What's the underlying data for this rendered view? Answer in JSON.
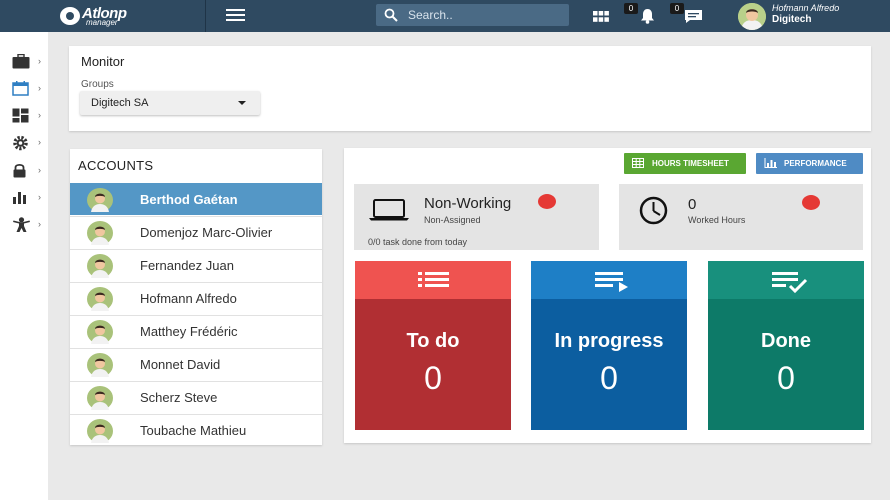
{
  "app": {
    "logo_main": "Atlonp",
    "logo_sub": "manager",
    "search_placeholder": "Search..",
    "notifications_count": "0",
    "messages_count": "0",
    "user_name": "Hofmann Alfredo",
    "user_org": "Digitech"
  },
  "sidebar": {
    "items": [
      {
        "icon": "briefcase-icon"
      },
      {
        "icon": "calendar-icon"
      },
      {
        "icon": "dashboard-icon"
      },
      {
        "icon": "gear-icon"
      },
      {
        "icon": "lock-icon"
      },
      {
        "icon": "bar-chart-icon"
      },
      {
        "icon": "person-icon"
      }
    ]
  },
  "monitor": {
    "title": "Monitor",
    "groups_label": "Groups",
    "groups_value": "Digitech SA"
  },
  "accounts": {
    "title": "ACCOUNTS",
    "items": [
      {
        "name": "Berthod Gaétan",
        "active": true
      },
      {
        "name": "Domenjoz Marc-Olivier"
      },
      {
        "name": "Fernandez Juan"
      },
      {
        "name": "Hofmann Alfredo"
      },
      {
        "name": "Matthey Frédéric"
      },
      {
        "name": "Monnet David"
      },
      {
        "name": "Scherz Steve"
      },
      {
        "name": "Toubache Mathieu"
      }
    ]
  },
  "dashboard": {
    "hours_timesheet_label": "HOURS TIMESHEET",
    "performance_label": "PERFORMANCE",
    "status_title": "Non-Working",
    "status_sub": "Non-Assigned",
    "tasks_done": "0/0 task done from today",
    "worked_hours_value": "0",
    "worked_hours_label": "Worked Hours",
    "tiles": [
      {
        "label": "To do",
        "count": "0",
        "top_color": "#ef5350",
        "bottom_color": "#b12f33"
      },
      {
        "label": "In progress",
        "count": "0",
        "top_color": "#1e7fc6",
        "bottom_color": "#0c5ea0"
      },
      {
        "label": "Done",
        "count": "0",
        "top_color": "#18907d",
        "bottom_color": "#0d7a68"
      }
    ]
  },
  "colors": {
    "topbar": "#2f4a61",
    "accent_blue": "#5497c6",
    "timesheet_green": "#5aa732",
    "performance_blue": "#4f8bc4",
    "status_red": "#e53935"
  }
}
